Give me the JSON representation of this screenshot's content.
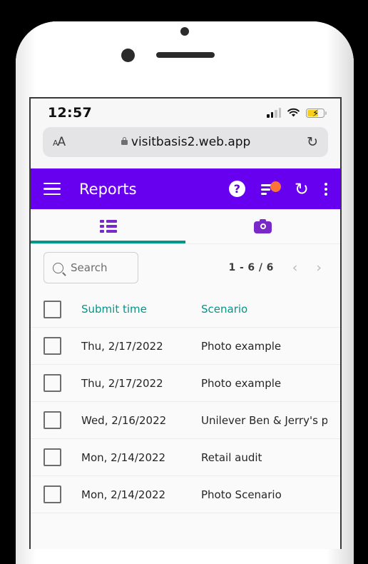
{
  "status_bar": {
    "time": "12:57",
    "signal_icon": "cellular-signal-icon",
    "wifi_icon": "wifi-icon",
    "battery_icon": "battery-charging-icon"
  },
  "browser": {
    "text_size_label": "AA",
    "lock_icon": "lock-icon",
    "url": "visitbasis2.web.app",
    "reload_icon": "reload-icon",
    "reload_glyph": "↻"
  },
  "appbar": {
    "menu_icon": "hamburger-menu-icon",
    "title": "Reports",
    "help_icon": "help-icon",
    "help_glyph": "?",
    "filter_icon": "filter-icon",
    "refresh_icon": "refresh-icon",
    "refresh_glyph": "↻",
    "overflow_icon": "overflow-menu-icon",
    "background": "#6600ee",
    "badge_color": "#fd7238"
  },
  "tabs": {
    "accent": "#009688",
    "items": [
      {
        "name": "list-view-tab",
        "icon": "list-view-icon",
        "active": true
      },
      {
        "name": "photo-view-tab",
        "icon": "camera-icon",
        "active": false
      }
    ]
  },
  "toolbar": {
    "search_placeholder": "Search",
    "search_value": "",
    "search_icon": "search-icon",
    "pagination_label": "1 - 6 / 6",
    "prev_glyph": "‹",
    "next_glyph": "›"
  },
  "table": {
    "columns": [
      "Submit time",
      "Scenario"
    ],
    "rows": [
      {
        "submit_time": "Thu, 2/17/2022",
        "scenario": "Photo example"
      },
      {
        "submit_time": "Thu, 2/17/2022",
        "scenario": "Photo example"
      },
      {
        "submit_time": "Wed, 2/16/2022",
        "scenario": "Unilever  Ben & Jerry's planogra."
      },
      {
        "submit_time": "Mon, 2/14/2022",
        "scenario": "Retail audit"
      },
      {
        "submit_time": "Mon, 2/14/2022",
        "scenario": "Photo Scenario"
      }
    ]
  }
}
